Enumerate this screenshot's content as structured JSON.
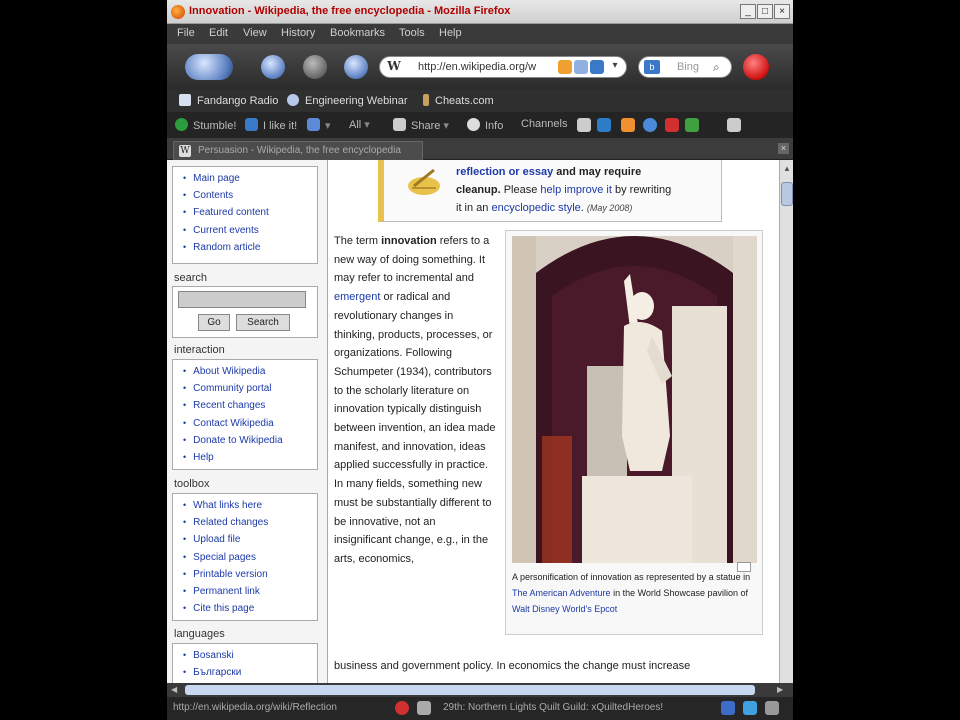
{
  "window": {
    "title": "Innovation - Wikipedia, the free encyclopedia - Mozilla Firefox"
  },
  "menu": [
    "File",
    "Edit",
    "View",
    "History",
    "Bookmarks",
    "Tools",
    "Help"
  ],
  "address": {
    "url": "http://en.wikipedia.org/w",
    "search_placeholder": "Bing"
  },
  "bookmarks": [
    "Fandango Radio",
    "Engineering Webinar",
    "Cheats.com"
  ],
  "toolbar2": {
    "items": [
      "Stumble!",
      "I like it!",
      "All",
      "Share",
      "Info",
      "Channels"
    ]
  },
  "tab": {
    "label": "Persuasion - Wikipedia, the free encyclopedia"
  },
  "sidebar": {
    "navigation": [
      "Main page",
      "Contents",
      "Featured content",
      "Current events",
      "Random article"
    ],
    "search": {
      "heading": "search",
      "go": "Go",
      "search": "Search"
    },
    "interaction": {
      "heading": "interaction",
      "items": [
        "About Wikipedia",
        "Community portal",
        "Recent changes",
        "Contact Wikipedia",
        "Donate to Wikipedia",
        "Help"
      ]
    },
    "toolbox": {
      "heading": "toolbox",
      "items": [
        "What links here",
        "Related changes",
        "Upload file",
        "Special pages",
        "Printable version",
        "Permanent link",
        "Cite this page"
      ]
    },
    "languages": {
      "heading": "languages",
      "items": [
        "Bosanski",
        "Български"
      ]
    }
  },
  "ambox": {
    "line1_link": "reflection or essay",
    "line1_rest": "and may require",
    "line2": "cleanup.",
    "line2_rest": "Please",
    "help_link": "help improve it",
    "line2_end": "by rewriting",
    "line3_start": "it in an",
    "style_link": "encyclopedic style",
    "date": "(May 2008)"
  },
  "article": {
    "p1_a": "The term",
    "p1_bold": "innovation",
    "p1_b": "refers to a new way of doing something. It may refer to incremental and",
    "p1_link": "emergent",
    "p1_c": "or radical and revolutionary changes in thinking, products, processes, or organizations. Following Schumpeter (1934), contributors to the scholarly literature on innovation typically distinguish between invention, an idea made manifest, and innovation, ideas applied successfully in practice. In many fields, something new must be substantially different to be innovative, not an insignificant change, e.g., in the arts, economics,",
    "tail": "business and government policy. In economics the change must increase"
  },
  "thumb": {
    "caption_a": "A personification of innovation as represented by a statue in",
    "caption_link1": "The American Adventure",
    "caption_b": "in the World Showcase pavilion of",
    "caption_link2": "Walt Disney World's Epcot"
  },
  "statusbar": {
    "url": "http://en.wikipedia.org/wiki/Reflection",
    "item2": "29th: Northern Lights Quilt Guild: xQuiltedHeroes!"
  }
}
